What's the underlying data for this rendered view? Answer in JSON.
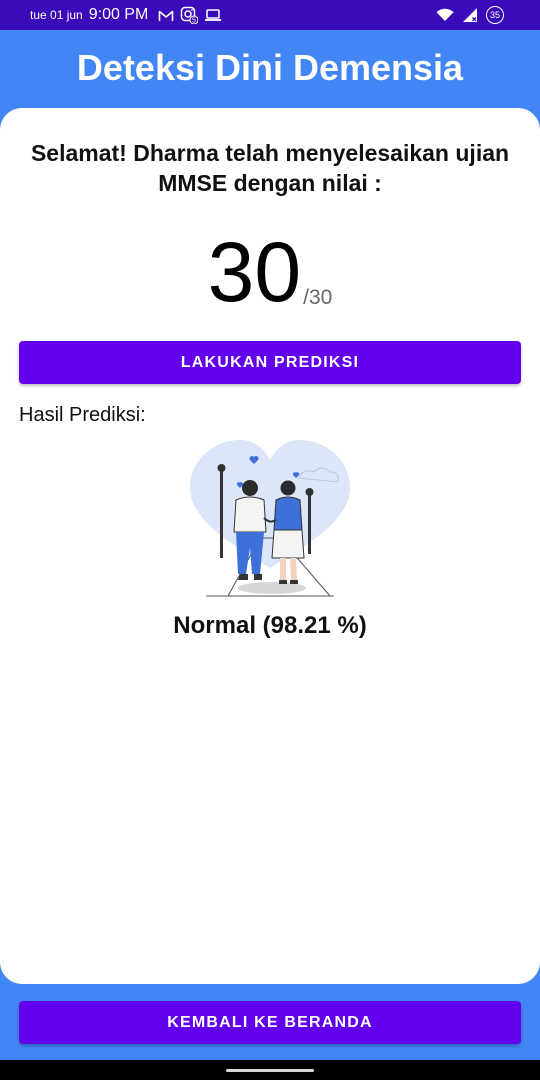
{
  "status_bar": {
    "date": "tue 01 jun",
    "time": "9:00 PM",
    "notification_count": "5",
    "battery": "35",
    "icons": [
      "gmail-icon",
      "instagram-icon",
      "laptop-icon",
      "wifi-icon",
      "signal-icon",
      "battery-icon"
    ]
  },
  "header": {
    "title": "Deteksi Dini Demensia"
  },
  "card": {
    "congrats_text": "Selamat! Dharma telah menyelesaikan ujian MMSE dengan nilai :",
    "score": "30",
    "score_max": "/30",
    "predict_button": "LAKUKAN PREDIKSI",
    "result_label": "Hasil Prediksi:",
    "result_text": "Normal (98.21 %)"
  },
  "footer": {
    "home_button": "KEMBALI KE BERANDA"
  },
  "colors": {
    "header_bg": "#4285F4",
    "status_bar_bg": "#3A0BB8",
    "button_bg": "#6200EE",
    "illustration_accent": "#3F6FD8",
    "illustration_bg": "#DCE6F9"
  }
}
